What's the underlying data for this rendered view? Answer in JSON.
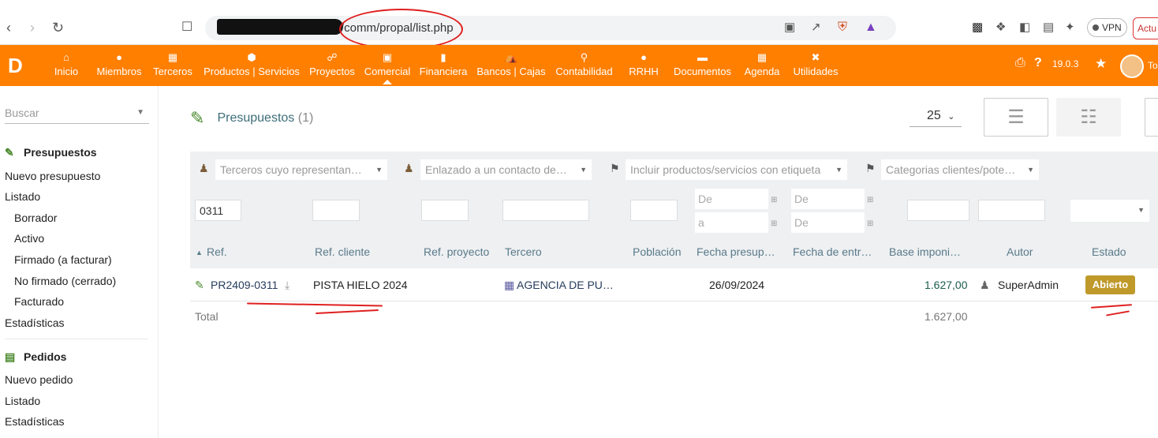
{
  "browser": {
    "url_suffix": "/comm/propal/list.php",
    "vpn_label": "VPN",
    "update_label": "Actu"
  },
  "topnav": {
    "logo": "D",
    "items": [
      {
        "label": "Inicio",
        "icon": "home-icon"
      },
      {
        "label": "Miembros",
        "icon": "user-icon"
      },
      {
        "label": "Terceros",
        "icon": "building-icon"
      },
      {
        "label": "Productos | Servicios",
        "icon": "cube-icon"
      },
      {
        "label": "Proyectos",
        "icon": "project-icon"
      },
      {
        "label": "Comercial",
        "icon": "briefcase-icon"
      },
      {
        "label": "Financiera",
        "icon": "invoice-icon"
      },
      {
        "label": "Bancos | Cajas",
        "icon": "bank-icon"
      },
      {
        "label": "Contabilidad",
        "icon": "search-dollar-icon"
      },
      {
        "label": "RRHH",
        "icon": "user-tie-icon"
      },
      {
        "label": "Documentos",
        "icon": "folder-icon"
      },
      {
        "label": "Agenda",
        "icon": "calendar-icon"
      },
      {
        "label": "Utilidades",
        "icon": "tools-icon"
      }
    ],
    "version": "19.0.3",
    "user_initial": "To"
  },
  "sidebar": {
    "search_placeholder": "Buscar",
    "section1_title": "Presupuestos",
    "section1_links": [
      "Nuevo presupuesto",
      "Listado",
      "Borrador",
      "Activo",
      "Firmado (a facturar)",
      "No firmado (cerrado)",
      "Facturado",
      "Estadísticas"
    ],
    "section2_title": "Pedidos",
    "section2_links": [
      "Nuevo pedido",
      "Listado",
      "Estadísticas"
    ]
  },
  "main": {
    "title": "Presupuestos",
    "count": "(1)",
    "limit": "25",
    "filters": {
      "thirdparty_rep": "Terceros cuyo representan…",
      "linked_contact": "Enlazado a un contacto de…",
      "product_tag": "Incluir productos/servicios con etiqueta",
      "customer_category": "Categorias clientes/pote…",
      "ref_value": "0311",
      "date_from": "De",
      "date_to": "a",
      "delivery_from": "De",
      "delivery_to": "De"
    },
    "columns": {
      "ref": "Ref.",
      "ref_client": "Ref. cliente",
      "ref_project": "Ref. proyecto",
      "thirdparty": "Tercero",
      "town": "Población",
      "date": "Fecha presup…",
      "delivery_date": "Fecha de entr…",
      "amount": "Base imponi…",
      "author": "Autor",
      "status": "Estado"
    },
    "row": {
      "ref": "PR2409-0311",
      "ref_client": "PISTA HIELO 2024",
      "thirdparty": "AGENCIA DE PU…",
      "date": "26/09/2024",
      "amount": "1.627,00",
      "author": "SuperAdmin",
      "status": "Abierto"
    },
    "total_label": "Total",
    "total_amount": "1.627,00"
  },
  "colors": {
    "topnav": "#ff7f00",
    "badge": "#bf9a2b",
    "annotation": "#e02020"
  }
}
